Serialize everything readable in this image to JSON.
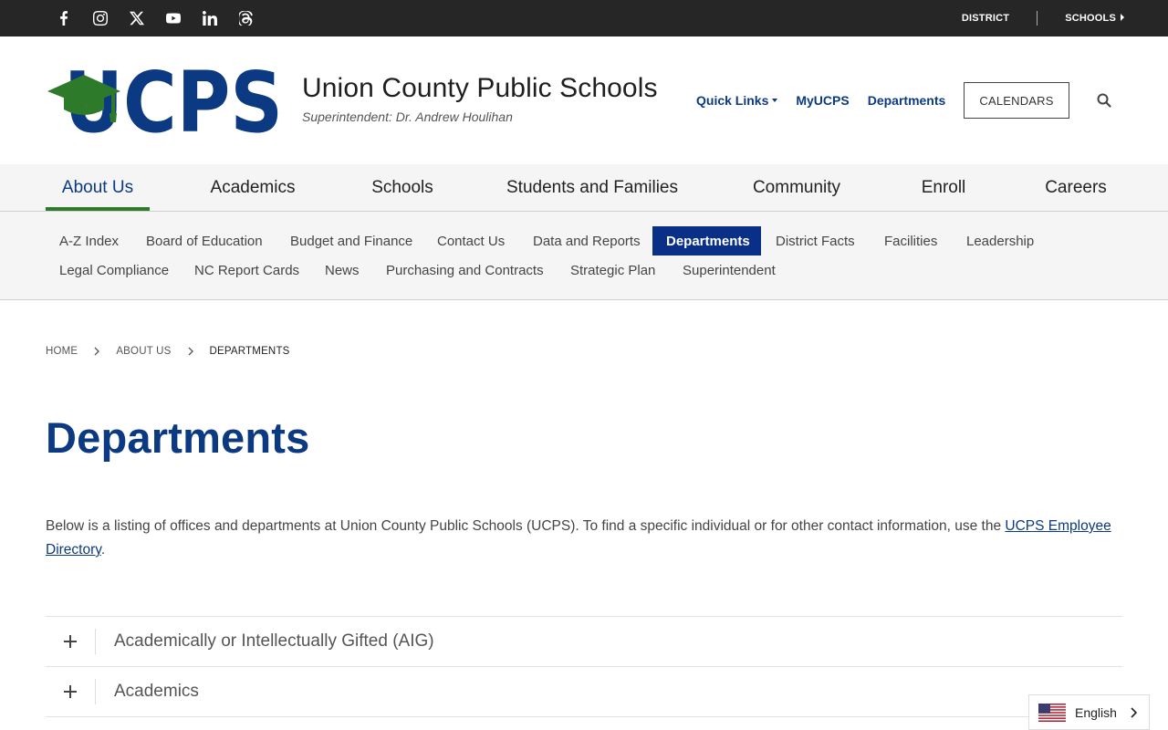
{
  "topbar": {
    "social": [
      "facebook-icon",
      "instagram-icon",
      "x-icon",
      "youtube-icon",
      "linkedin-icon",
      "threads-icon"
    ],
    "district_label": "DISTRICT",
    "schools_label": "SCHOOLS"
  },
  "header": {
    "logo_text": "UCPS",
    "title": "Union County Public Schools",
    "subtitle": "Superintendent: Dr. Andrew Houlihan",
    "links": {
      "quick_links": "Quick Links",
      "myucps": "MyUCPS",
      "departments": "Departments"
    },
    "calendars_label": "CALENDARS"
  },
  "colors": {
    "brand_navy": "#0b3a82",
    "brand_green": "#2d7a2a",
    "active_sub_bg": "#0a2f86",
    "topbar_bg": "#262626"
  },
  "mainnav": {
    "items": [
      "About Us",
      "Academics",
      "Schools",
      "Students and Families",
      "Community",
      "Enroll",
      "Careers"
    ],
    "active": "About Us"
  },
  "subnav": {
    "items": [
      "A-Z Index",
      "Board of Education",
      "Budget and Finance",
      "Contact Us",
      "Data and Reports",
      "Departments",
      "District Facts",
      "Facilities",
      "Leadership",
      "Legal Compliance",
      "NC Report Cards",
      "News",
      "Purchasing and Contracts",
      "Strategic Plan",
      "Superintendent"
    ],
    "active": "Departments"
  },
  "breadcrumb": {
    "home": "HOME",
    "about": "ABOUT US",
    "current": "DEPARTMENTS"
  },
  "page": {
    "title": "Departments",
    "intro_text": "Below is a listing of offices and departments at Union County Public Schools (UCPS). To find a specific individual or for other contact information, use the ",
    "intro_link": "UCPS Employee Directory",
    "intro_end": "."
  },
  "accordion": [
    "Academically or Intellectually Gifted (AIG)",
    "Academics"
  ],
  "language": {
    "label": "English"
  }
}
